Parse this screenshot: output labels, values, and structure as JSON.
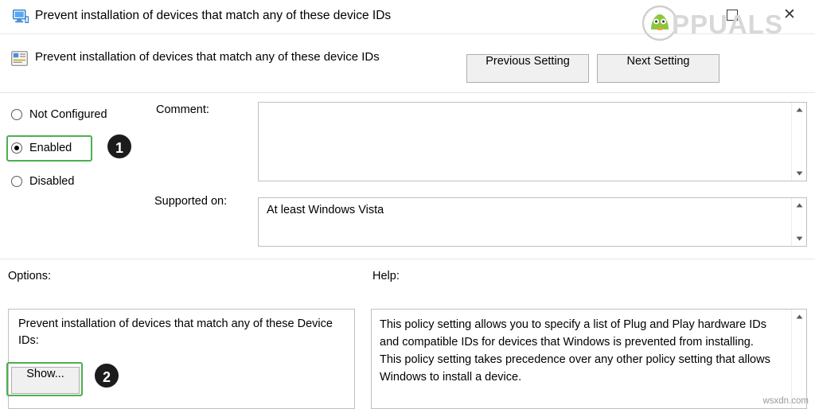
{
  "window": {
    "title": "Prevent installation of devices that match any of these device IDs",
    "icon": "monitor-policy-icon",
    "restore_label": "restore-window",
    "close_label": "✕"
  },
  "watermark": {
    "text": "PPUALS",
    "badge": "appuals-logo-badge",
    "credit": "wsxdn.com"
  },
  "header": {
    "icon": "policy-setting-icon",
    "label": "Prevent installation of devices that match  any of these device IDs",
    "previous_setting": "Previous Setting",
    "next_setting": "Next Setting"
  },
  "state_options": [
    {
      "label": "Not Configured",
      "checked": false
    },
    {
      "label": "Enabled",
      "checked": true
    },
    {
      "label": "Disabled",
      "checked": false
    }
  ],
  "comment": {
    "label": "Comment:",
    "value": "",
    "placeholder": ""
  },
  "supported_on": {
    "label": "Supported on:",
    "value": "At least Windows Vista"
  },
  "options": {
    "label": "Options:",
    "text": "Prevent installation of devices that match any of these Device IDs:",
    "show_button": "Show..."
  },
  "help": {
    "label": "Help:",
    "text": "This policy setting allows you to specify a list of Plug and Play hardware IDs and compatible IDs for devices that Windows is prevented from installing. This policy setting takes precedence over any other policy setting that allows Windows to install a device."
  },
  "annotations": {
    "callout_1": "1",
    "callout_2": "2",
    "highlight_color": "#4caf50"
  },
  "scrollbar": {
    "up": "▲",
    "down": "▼"
  }
}
